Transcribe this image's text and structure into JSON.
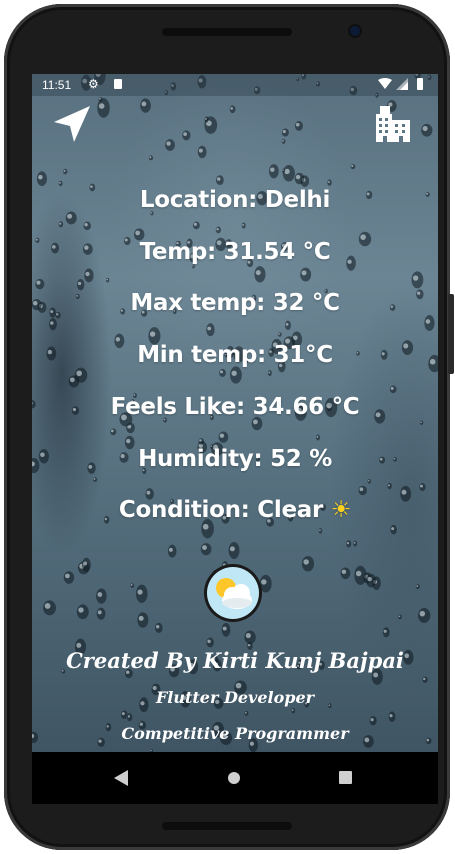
{
  "status_bar": {
    "time": "11:51",
    "icons": [
      "gear-icon",
      "sd-card-icon",
      "wifi-icon",
      "signal-icon",
      "battery-icon"
    ]
  },
  "toolbar": {
    "left_icon": "navigation-arrow-icon",
    "right_icon": "city-building-icon"
  },
  "weather": {
    "location": "Location: Delhi",
    "temp": "Temp: 31.54 °C",
    "max_temp": "Max temp: 32 °C",
    "min_temp": "Min temp: 31°C",
    "feels_like": "Feels Like: 34.66 °C",
    "humidity": "Humidity: 52 %",
    "condition": "Condition: Clear",
    "condition_emoji": "☀",
    "condition_icon": "partly-cloudy-icon"
  },
  "credits": {
    "author": "Created By Kirti Kunj Bajpai",
    "role1": "Flutter Developer",
    "role2": "Competitive Programmer"
  },
  "navigation_bar": {
    "buttons": [
      "back-icon",
      "home-icon",
      "recents-icon"
    ]
  },
  "colors": {
    "text": "#ffffff",
    "sun_emoji": "#ffd11a",
    "background_rain": "#5f7988"
  }
}
